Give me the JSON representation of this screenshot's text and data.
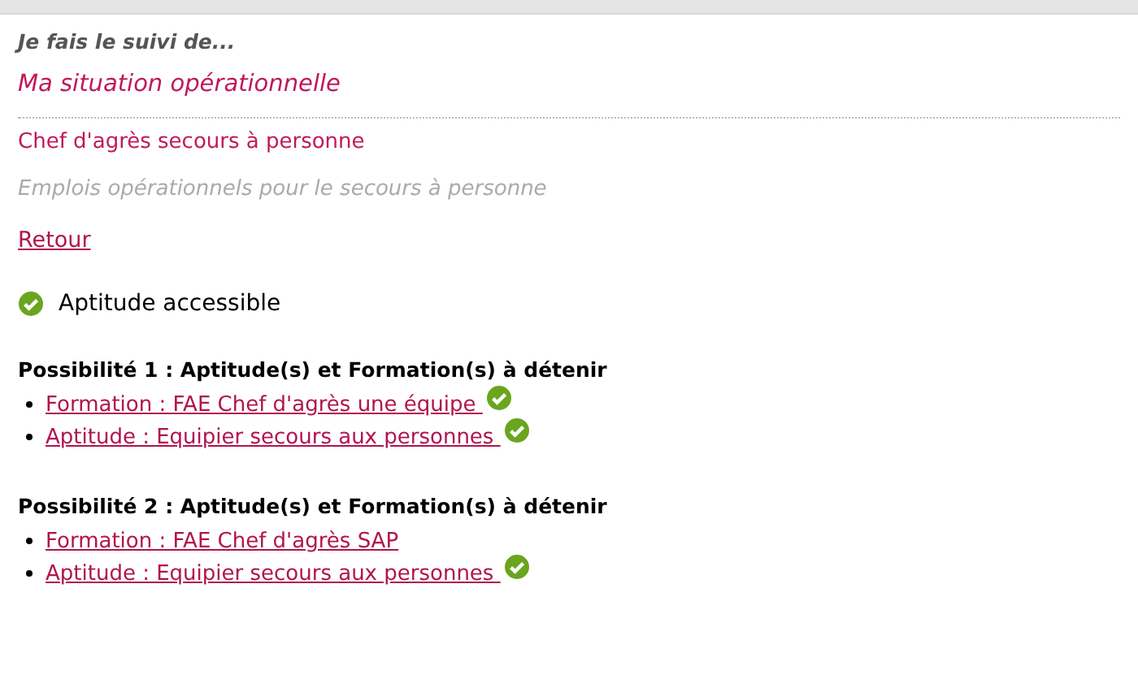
{
  "breadcrumb": "Je fais le suivi de...",
  "section_title": "Ma situation opérationnelle",
  "job_title": "Chef d'agrès secours à personne",
  "job_category": "Emplois opérationnels pour le secours à personne",
  "back_link": "Retour",
  "status": {
    "label": "Aptitude accessible",
    "accessible": true
  },
  "possibilities": [
    {
      "heading": "Possibilité 1 : Aptitude(s) et Formation(s) à détenir",
      "items": [
        {
          "label": "Formation : FAE Chef d'agrès une équipe ",
          "acquired": true
        },
        {
          "label": "Aptitude : Equipier secours aux personnes ",
          "acquired": true
        }
      ]
    },
    {
      "heading": "Possibilité 2 : Aptitude(s) et Formation(s) à détenir",
      "items": [
        {
          "label": "Formation : FAE Chef d'agrès SAP",
          "acquired": false
        },
        {
          "label": "Aptitude : Equipier secours aux personnes ",
          "acquired": true
        }
      ]
    }
  ]
}
